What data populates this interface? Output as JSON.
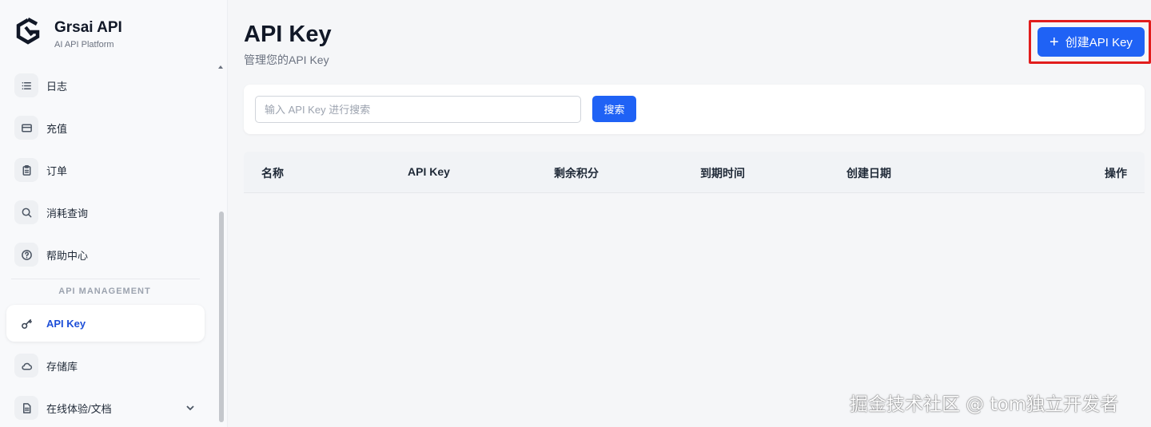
{
  "brand": {
    "name": "Grsai API",
    "subtitle": "AI API Platform"
  },
  "sidebar": {
    "items": [
      {
        "label": "日志",
        "icon": "list-icon"
      },
      {
        "label": "充值",
        "icon": "credit-card-icon"
      },
      {
        "label": "订单",
        "icon": "clipboard-icon"
      },
      {
        "label": "消耗查询",
        "icon": "search-icon"
      },
      {
        "label": "帮助中心",
        "icon": "help-circle-icon"
      }
    ],
    "section_label": "API MANAGEMENT",
    "management_items": [
      {
        "label": "API Key",
        "icon": "key-icon",
        "active": true
      },
      {
        "label": "存储库",
        "icon": "cloud-icon"
      },
      {
        "label": "在线体验/文档",
        "icon": "document-icon",
        "expandable": true
      }
    ]
  },
  "header": {
    "title": "API Key",
    "subtitle": "管理您的API Key",
    "create_button": "创建API Key"
  },
  "search": {
    "placeholder": "输入 API Key 进行搜索",
    "value": "",
    "button": "搜索"
  },
  "table": {
    "columns": [
      "名称",
      "API Key",
      "剩余积分",
      "到期时间",
      "创建日期",
      "操作"
    ],
    "rows": []
  },
  "watermark": "掘金技术社区 @ tom独立开发者",
  "colors": {
    "accent": "#1f62f5",
    "active_text": "#1e4fd8",
    "highlight_border": "#e11d1d"
  }
}
